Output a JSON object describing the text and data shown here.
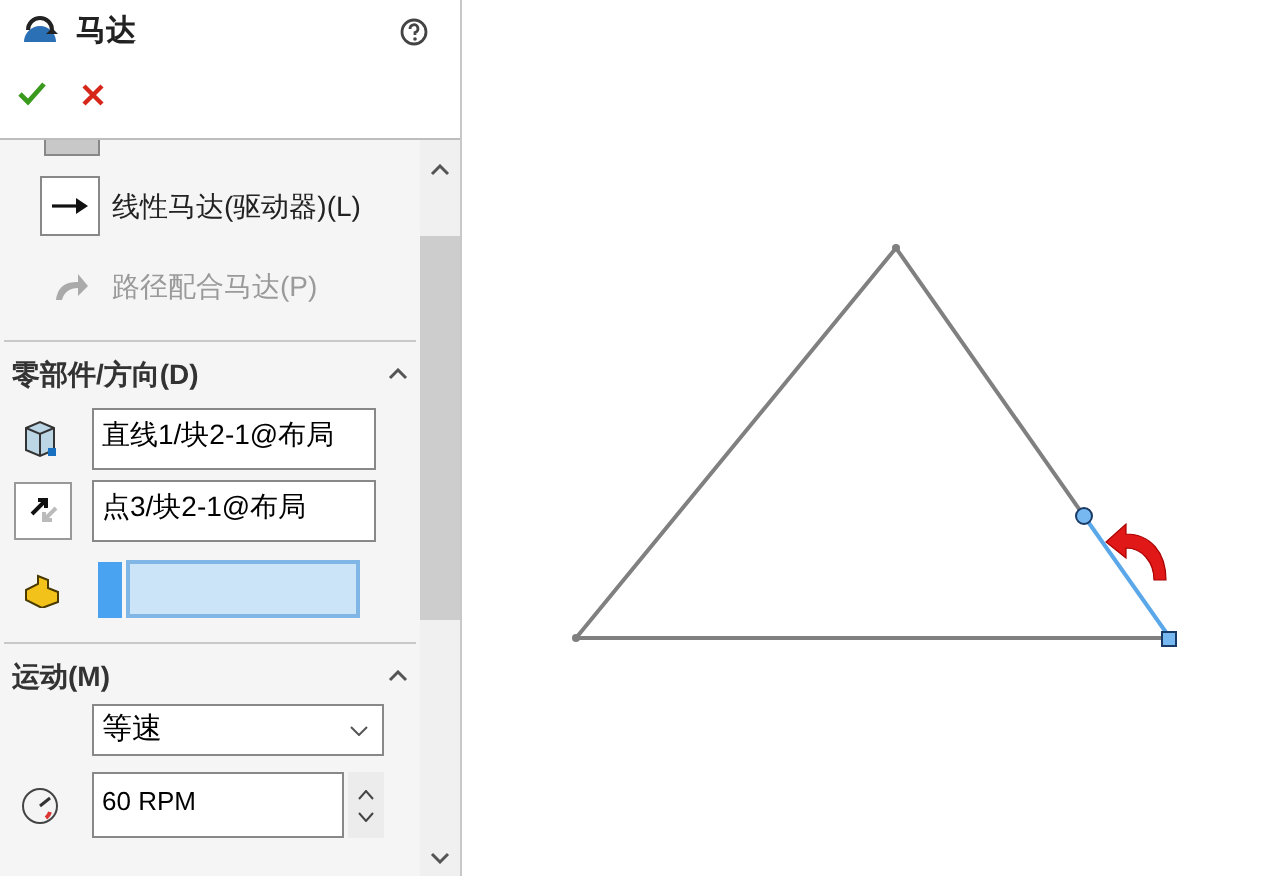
{
  "panel": {
    "title": "马达"
  },
  "motor_types": [
    {
      "label": "线性马达(驱动器)(L)",
      "selected": true,
      "disabled": false
    },
    {
      "label": "路径配合马达(P)",
      "selected": false,
      "disabled": true
    }
  ],
  "component_section": {
    "title": "零部件/方向(D)",
    "expanded": true,
    "fields": [
      {
        "value": "直线1/块2-1@布局"
      },
      {
        "value": "点3/块2-1@布局"
      }
    ]
  },
  "motion_section": {
    "title": "运动(M)",
    "expanded": true,
    "type": "等速",
    "speed": "60 RPM"
  }
}
